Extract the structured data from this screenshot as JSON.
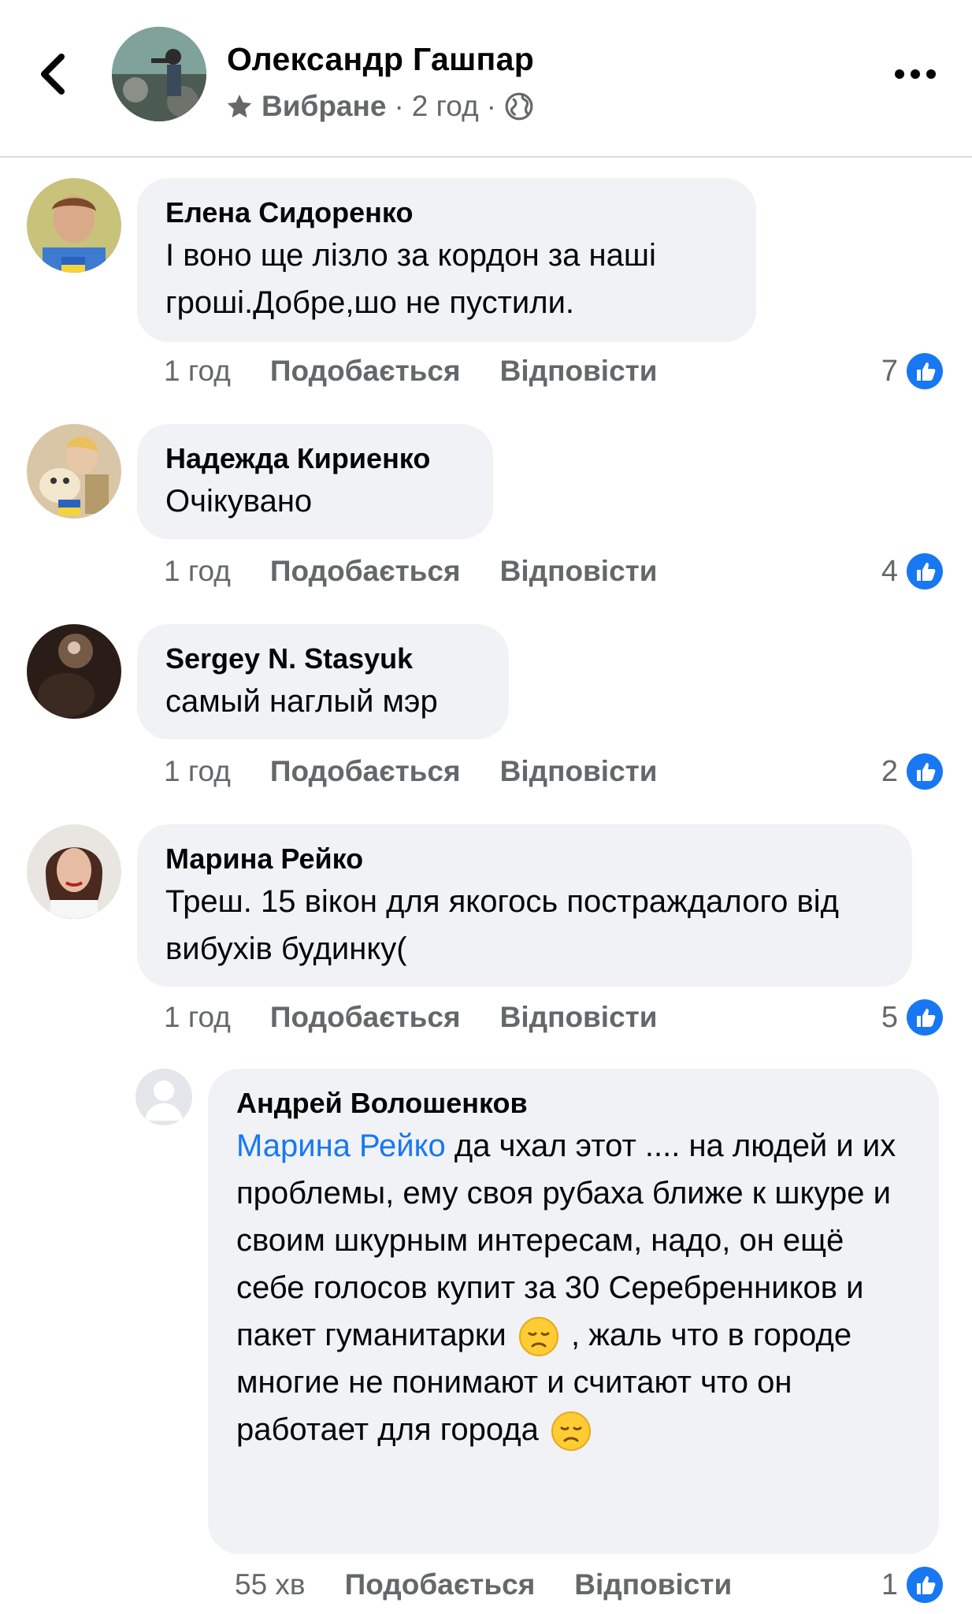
{
  "header": {
    "author": "Олександр Гашпар",
    "favorite_label": "Вибране",
    "separator": "·",
    "time": "2 год",
    "separator2": "·"
  },
  "colors": {
    "accent": "#1877f2",
    "bubble": "#f0f2f5",
    "meta": "#65676b"
  },
  "comments": [
    {
      "author": "Елена Сидоренко",
      "text": "І воно ще лізло за кордон за наші гроші.Добре,шо не пустили.",
      "time": "1 год",
      "like_label": "Подобається",
      "reply_label": "Відповісти",
      "reactions": "7"
    },
    {
      "author": "Надежда Кириенко",
      "text": "Очікувано",
      "time": "1 год",
      "like_label": "Подобається",
      "reply_label": "Відповісти",
      "reactions": "4"
    },
    {
      "author": "Sergey N. Stasyuk",
      "text": "самый наглый мэр",
      "time": "1 год",
      "like_label": "Подобається",
      "reply_label": "Відповісти",
      "reactions": "2"
    },
    {
      "author": "Марина Рейко",
      "text": "Треш. 15 вікон для якогось постраждалого від вибухів будинку(",
      "time": "1 год",
      "like_label": "Подобається",
      "reply_label": "Відповісти",
      "reactions": "5"
    }
  ],
  "reply": {
    "author": "Андрей Волошенков",
    "mention": "Марина Рейко",
    "text_part1": " да чхал этот .... на людей и их проблемы, ему своя рубаха ближе к шкуре и своим шкурным интересам, надо, он ещё себе голосов купит за 30 Серебренников и пакет гуманитарки",
    "text_part2": " , жаль что в городе многие не понимают и считают что он работает для города",
    "emoji_name": "disappointed-face-icon",
    "time": "55 хв",
    "like_label": "Подобається",
    "reply_label": "Відповісти",
    "reactions": "1"
  }
}
